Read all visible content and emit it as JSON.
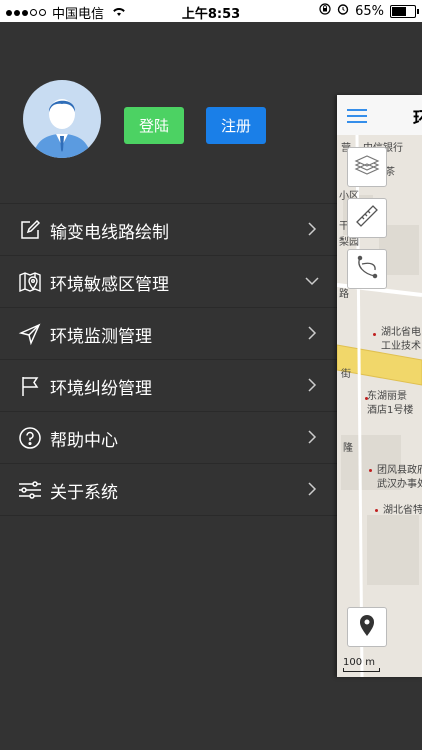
{
  "status": {
    "carrier": "中国电信",
    "time": "上午8:53",
    "battery": "65%",
    "battery_level": 0.65
  },
  "auth": {
    "login_label": "登陆",
    "register_label": "注册"
  },
  "menu": {
    "items": [
      {
        "label": "输变电线路绘制",
        "icon": "edit-icon",
        "chevron": "chevron-right-icon"
      },
      {
        "label": "环境敏感区管理",
        "icon": "map-pin-icon",
        "chevron": "chevron-down-icon"
      },
      {
        "label": "环境监测管理",
        "icon": "send-icon",
        "chevron": "chevron-right-icon"
      },
      {
        "label": "环境纠纷管理",
        "icon": "flag-icon",
        "chevron": "chevron-right-icon"
      },
      {
        "label": "帮助中心",
        "icon": "help-icon",
        "chevron": "chevron-right-icon"
      },
      {
        "label": "关于系统",
        "icon": "sliders-icon",
        "chevron": "chevron-right-icon"
      }
    ]
  },
  "map": {
    "title": "环",
    "labels": [
      "中信银行",
      "小区",
      "干",
      "梨园",
      "湖北省电",
      "工业技术",
      "街",
      "东湖丽景",
      "酒店1号楼",
      "团风县政府",
      "武汉办事处",
      "湖北省特",
      "茶",
      "营",
      "隆",
      "路"
    ],
    "scale": "100 m"
  },
  "colors": {
    "background": "#333333",
    "login": "#4cd263",
    "register": "#1a7fe8"
  }
}
